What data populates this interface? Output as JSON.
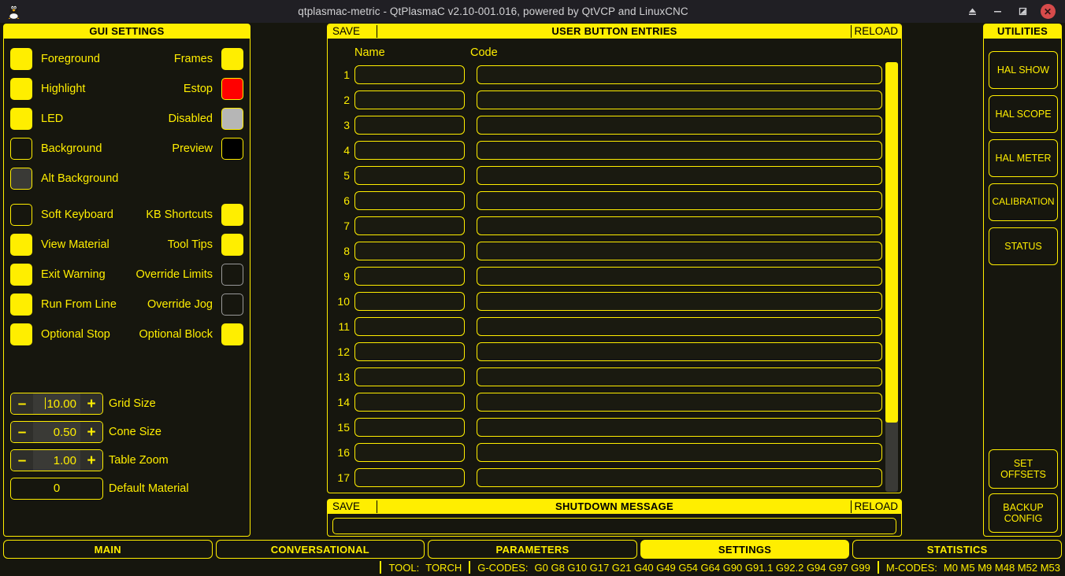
{
  "titlebar": {
    "app_icon": "linux-penguin-icon",
    "title": "qtplasmac-metric - QtPlasmaC v2.10-001.016, powered by QtVCP and LinuxCNC",
    "controls": [
      {
        "name": "eject-button",
        "glyph": "⏏"
      },
      {
        "name": "minimize-button",
        "glyph": "–"
      },
      {
        "name": "maximize-button",
        "glyph": "❐"
      },
      {
        "name": "close-button",
        "glyph": "✕"
      }
    ]
  },
  "gui_settings": {
    "title": "GUI SETTINGS",
    "color_rows": [
      {
        "label": "Foreground",
        "color": "#ffee00",
        "side": "left"
      },
      {
        "label": "Frames",
        "color": "#ffee00",
        "side": "right"
      },
      {
        "label": "Highlight",
        "color": "#ffee00",
        "side": "left"
      },
      {
        "label": "Estop",
        "color": "#ff0000",
        "side": "right"
      },
      {
        "label": "LED",
        "color": "#ffee00",
        "side": "left"
      },
      {
        "label": "Disabled",
        "color": "#b6b6b6",
        "side": "right"
      },
      {
        "label": "Background",
        "color": "#16160e",
        "side": "left"
      },
      {
        "label": "Preview",
        "color": "#000000",
        "side": "right"
      },
      {
        "label": "Alt Background",
        "color": "#3a3a36",
        "side": "left"
      }
    ],
    "checkboxes": [
      {
        "label": "Soft Keyboard",
        "checked": false,
        "side": "left"
      },
      {
        "label": "KB Shortcuts",
        "checked": true,
        "side": "right"
      },
      {
        "label": "View Material",
        "checked": true,
        "side": "left"
      },
      {
        "label": "Tool Tips",
        "checked": true,
        "side": "right"
      },
      {
        "label": "Exit Warning",
        "checked": true,
        "side": "left"
      },
      {
        "label": "Override Limits",
        "checked": false,
        "side": "right"
      },
      {
        "label": "Run From Line",
        "checked": true,
        "side": "left"
      },
      {
        "label": "Override Jog",
        "checked": false,
        "side": "right"
      },
      {
        "label": "Optional Stop",
        "checked": true,
        "side": "left"
      },
      {
        "label": "Optional Block",
        "checked": true,
        "side": "right"
      }
    ],
    "spinners": [
      {
        "label": "Grid Size",
        "value": "10.00",
        "focused": true,
        "minus": "–",
        "plus": "+"
      },
      {
        "label": "Cone Size",
        "value": "0.50",
        "focused": false,
        "minus": "–",
        "plus": "+"
      },
      {
        "label": "Table Zoom",
        "value": "1.00",
        "focused": false,
        "minus": "–",
        "plus": "+"
      }
    ],
    "default_material": {
      "label": "Default Material",
      "value": "0"
    }
  },
  "user_buttons": {
    "header": {
      "save": "SAVE",
      "title": "USER BUTTON ENTRIES",
      "reload": "RELOAD"
    },
    "columns": {
      "name": "Name",
      "code": "Code"
    },
    "rows": [
      {
        "num": "1",
        "name": "",
        "code": ""
      },
      {
        "num": "2",
        "name": "",
        "code": ""
      },
      {
        "num": "3",
        "name": "",
        "code": ""
      },
      {
        "num": "4",
        "name": "",
        "code": ""
      },
      {
        "num": "5",
        "name": "",
        "code": ""
      },
      {
        "num": "6",
        "name": "",
        "code": ""
      },
      {
        "num": "7",
        "name": "",
        "code": ""
      },
      {
        "num": "8",
        "name": "",
        "code": ""
      },
      {
        "num": "9",
        "name": "",
        "code": ""
      },
      {
        "num": "10",
        "name": "",
        "code": ""
      },
      {
        "num": "11",
        "name": "",
        "code": ""
      },
      {
        "num": "12",
        "name": "",
        "code": ""
      },
      {
        "num": "13",
        "name": "",
        "code": ""
      },
      {
        "num": "14",
        "name": "",
        "code": ""
      },
      {
        "num": "15",
        "name": "",
        "code": ""
      },
      {
        "num": "16",
        "name": "",
        "code": ""
      },
      {
        "num": "17",
        "name": "",
        "code": ""
      }
    ]
  },
  "shutdown": {
    "header": {
      "save": "SAVE",
      "title": "SHUTDOWN MESSAGE",
      "reload": "RELOAD"
    },
    "message": ""
  },
  "utilities": {
    "title": "UTILITIES",
    "buttons": [
      {
        "name": "hal-show-button",
        "label": "HAL SHOW"
      },
      {
        "name": "hal-scope-button",
        "label": "HAL SCOPE"
      },
      {
        "name": "hal-meter-button",
        "label": "HAL METER"
      },
      {
        "name": "calibration-button",
        "label": "CALIBRATION"
      },
      {
        "name": "status-button",
        "label": "STATUS"
      }
    ],
    "bottom_buttons": [
      {
        "name": "set-offsets-button",
        "line1": "SET",
        "line2": "OFFSETS"
      },
      {
        "name": "backup-config-button",
        "line1": "BACKUP",
        "line2": "CONFIG"
      }
    ]
  },
  "tabs": [
    {
      "label": "MAIN",
      "active": false
    },
    {
      "label": "CONVERSATIONAL",
      "active": false
    },
    {
      "label": "PARAMETERS",
      "active": false
    },
    {
      "label": "SETTINGS",
      "active": true
    },
    {
      "label": "STATISTICS",
      "active": false
    }
  ],
  "statusbar": {
    "tool_key": "TOOL:",
    "tool_value": "TORCH",
    "gcodes_key": "G-CODES:",
    "gcodes_value": "G0 G8 G10 G17 G21 G40 G49 G54 G64 G90 G91.1 G92.2 G94 G97 G99",
    "mcodes_key": "M-CODES:",
    "mcodes_value": "M0 M5 M9 M48 M52 M53"
  },
  "theme": {
    "accent": "#ffee00",
    "background": "#16160e",
    "titlebar_bg": "#201f24",
    "estop": "#ff0000",
    "disabled": "#b6b6b6"
  }
}
